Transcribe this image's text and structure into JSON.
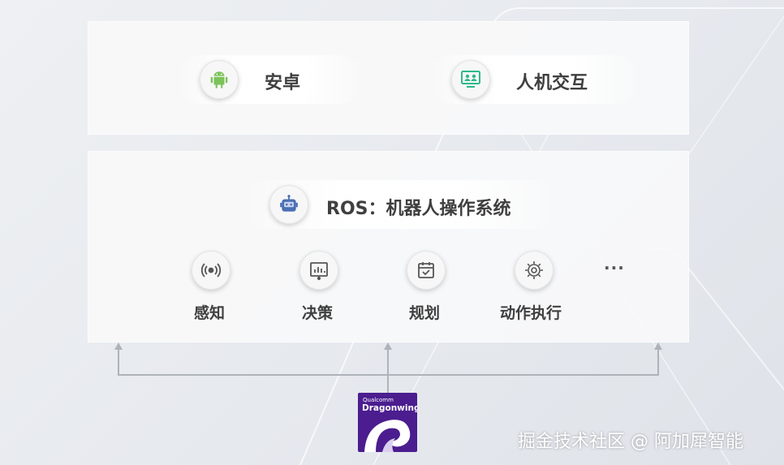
{
  "top_layer": {
    "items": [
      {
        "label": "安卓",
        "icon": "android-icon",
        "color": "#7cc35a"
      },
      {
        "label": "人机交互",
        "icon": "monitor-people-icon",
        "color": "#2fb98a"
      }
    ]
  },
  "ros_layer": {
    "title": "ROS：机器人操作系统",
    "icon": "robot-icon",
    "icon_color": "#4a6fb3",
    "modules": [
      {
        "label": "感知",
        "icon": "sensing-icon"
      },
      {
        "label": "决策",
        "icon": "chart-board-icon"
      },
      {
        "label": "规划",
        "icon": "calendar-check-icon"
      },
      {
        "label": "动作执行",
        "icon": "gear-icon"
      }
    ],
    "more": "···"
  },
  "platform": {
    "brand_line1": "Qualcomm",
    "brand_line2": "Dragonwing",
    "color": "#4b1d8f"
  },
  "watermark": "掘金技术社区 @ 阿加犀智能"
}
